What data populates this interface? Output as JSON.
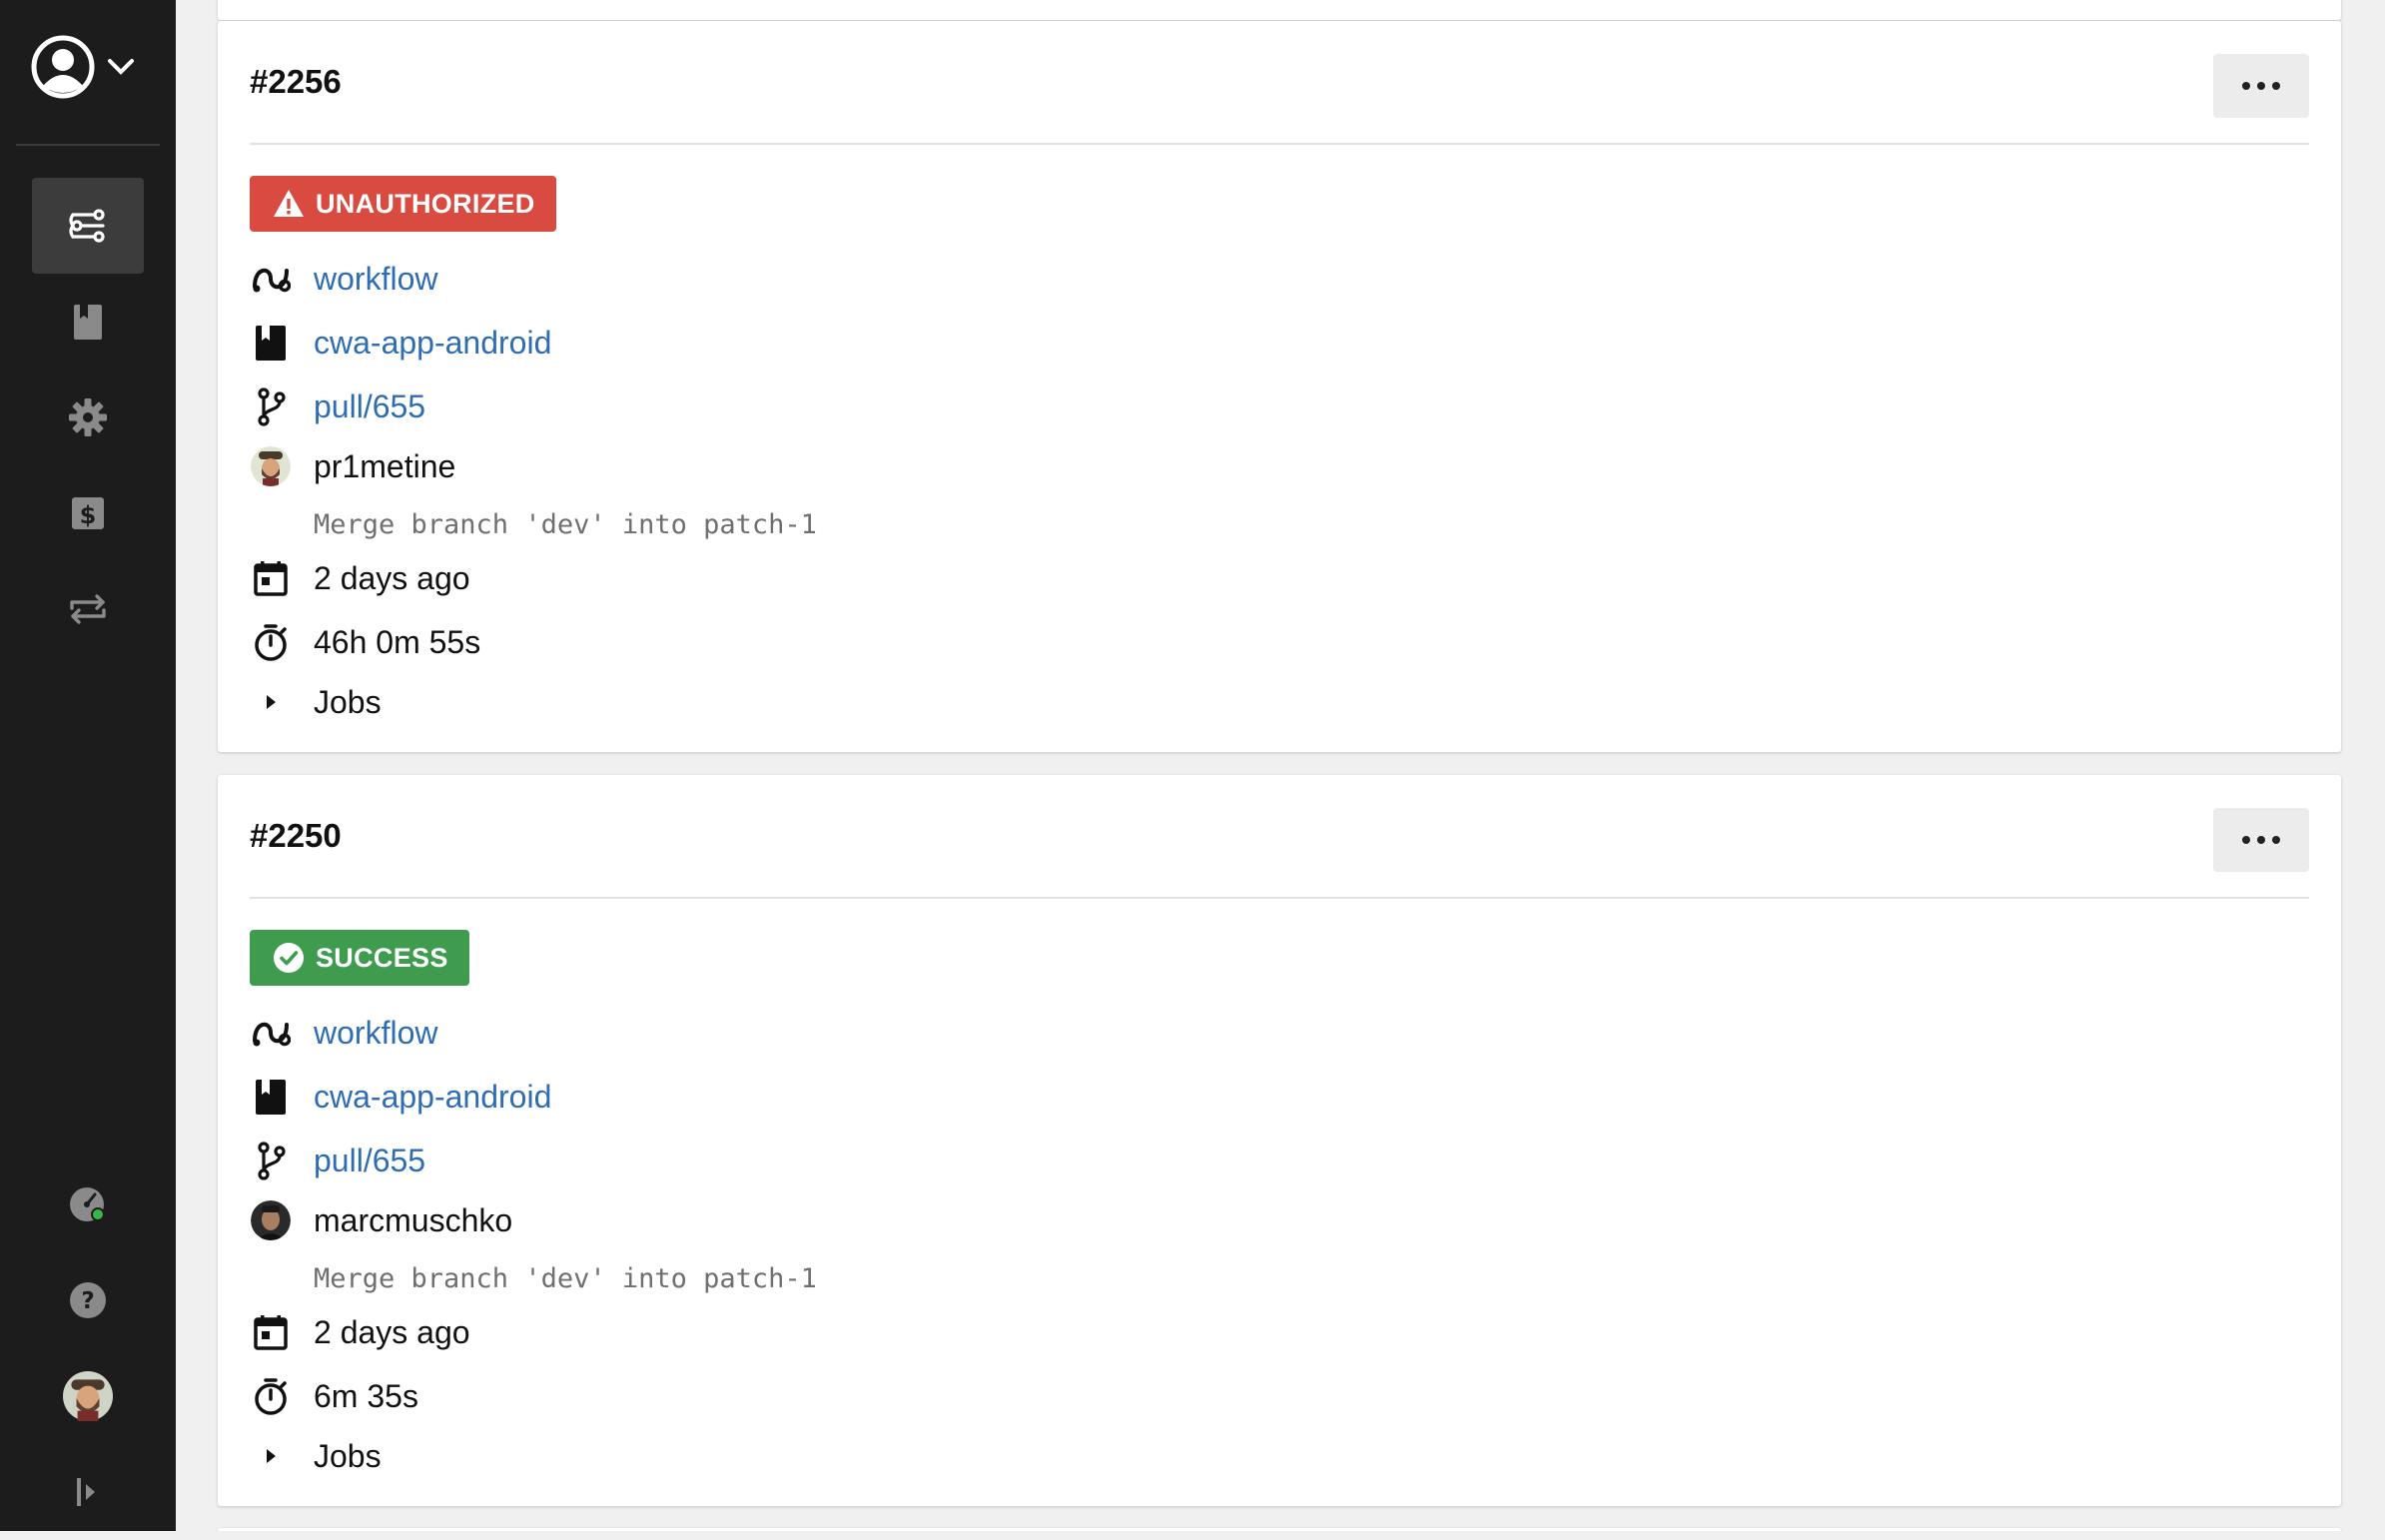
{
  "colors": {
    "sidebar_bg": "#1c1c1c",
    "link": "#2e6db4",
    "unauthorized": "#d94b40",
    "success": "#3f9c4f"
  },
  "sidebar": {
    "items": [
      {
        "icon": "pipelines-icon",
        "active": true
      },
      {
        "icon": "repository-icon",
        "active": false
      },
      {
        "icon": "gear-icon",
        "active": false
      },
      {
        "icon": "billing-icon",
        "active": false
      },
      {
        "icon": "swap-icon",
        "active": false
      }
    ],
    "bottom_items": [
      {
        "icon": "speedometer-icon"
      },
      {
        "icon": "help-icon"
      },
      {
        "icon": "user-avatar"
      },
      {
        "icon": "expand-sidebar-icon"
      }
    ]
  },
  "builds": [
    {
      "id": "#2256",
      "status": "UNAUTHORIZED",
      "status_color": "#d94b40",
      "workflow": "workflow",
      "repository": "cwa-app-android",
      "branch": "pull/655",
      "author": "pr1metine",
      "message": "Merge branch 'dev' into patch-1",
      "started": "2 days ago",
      "duration": "46h 0m 55s",
      "jobs_label": "Jobs"
    },
    {
      "id": "#2250",
      "status": "SUCCESS",
      "status_color": "#3f9c4f",
      "workflow": "workflow",
      "repository": "cwa-app-android",
      "branch": "pull/655",
      "author": "marcmuschko",
      "message": "Merge branch 'dev' into patch-1",
      "started": "2 days ago",
      "duration": "6m 35s",
      "jobs_label": "Jobs"
    }
  ]
}
